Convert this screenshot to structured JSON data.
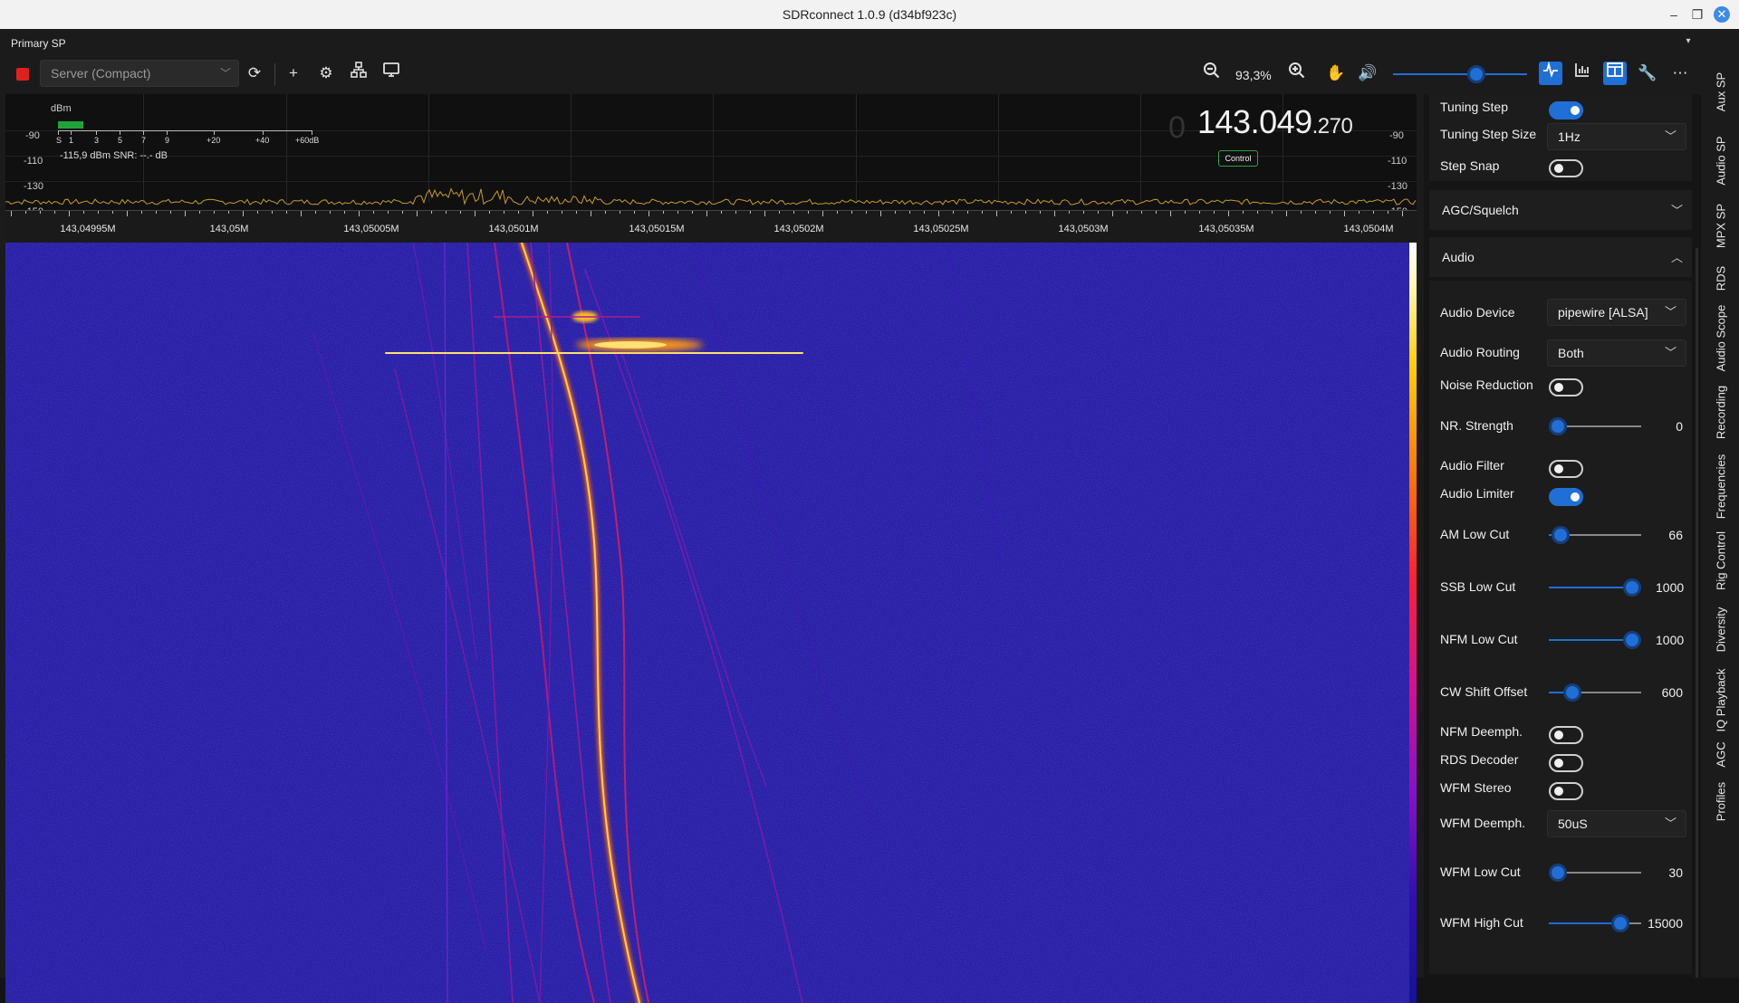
{
  "window": {
    "title": "SDRconnect 1.0.9 (d34bf923c)",
    "minimize": "–",
    "restore": "❐",
    "close": "✕"
  },
  "sp_label": "Primary SP",
  "toolbar": {
    "server_value": "Server (Compact)",
    "zoom_level": "93,3%",
    "volume_level": 0.64,
    "icons": [
      "stop-icon",
      "refresh-icon",
      "add-icon",
      "settings-icon",
      "network-icon",
      "display-icon",
      "zoom-out-icon",
      "zoom-in-icon",
      "hand-icon",
      "volume-icon",
      "waveform-icon",
      "histogram-icon",
      "layout-icon",
      "wrench-icon",
      "more-icon"
    ]
  },
  "spectrum": {
    "unit": "dBm",
    "levels_left": [
      "-90",
      "-110",
      "-130",
      "-150"
    ],
    "levels_right": [
      "-90",
      "-110",
      "-130",
      "-150"
    ],
    "smeter_labels": [
      "S",
      "1",
      "3",
      "5",
      "7",
      "9",
      "+20",
      "+40",
      "+60dB"
    ],
    "readout": "-115,9 dBm   SNR:  --.- dB",
    "freq_ghost": "0",
    "freq_main": "143.049",
    "freq_fine": ".270",
    "control_badge": "Control",
    "axis_labels": [
      "143,04995M",
      "143,05M",
      "143,05005M",
      "143,0501M",
      "143,05015M",
      "143,0502M",
      "143,05025M",
      "143,0503M",
      "143,05035M",
      "143,0504M"
    ]
  },
  "panel": {
    "tuning_step_label": "Tuning Step",
    "tuning_step_on": true,
    "tuning_step_size_label": "Tuning Step Size",
    "tuning_step_size_value": "1Hz",
    "step_snap_label": "Step Snap",
    "step_snap_on": false,
    "agc_header": "AGC/Squelch",
    "audio_header": "Audio",
    "audio_device_label": "Audio Device",
    "audio_device_value": "pipewire [ALSA]",
    "audio_routing_label": "Audio Routing",
    "audio_routing_value": "Both",
    "noise_reduction_label": "Noise Reduction",
    "noise_reduction_on": false,
    "nr_strength_label": "NR. Strength",
    "nr_strength_value": "0",
    "nr_strength_frac": 0.0,
    "audio_filter_label": "Audio Filter",
    "audio_filter_on": false,
    "audio_limiter_label": "Audio Limiter",
    "audio_limiter_on": true,
    "am_low_cut_label": "AM Low Cut",
    "am_low_cut_value": "66",
    "am_low_cut_frac": 0.04,
    "ssb_low_cut_label": "SSB Low Cut",
    "ssb_low_cut_value": "1000",
    "ssb_low_cut_frac": 1.0,
    "nfm_low_cut_label": "NFM Low Cut",
    "nfm_low_cut_value": "1000",
    "nfm_low_cut_frac": 1.0,
    "cw_shift_label": "CW Shift Offset",
    "cw_shift_value": "600",
    "cw_shift_frac": 0.2,
    "nfm_deemph_label": "NFM Deemph.",
    "nfm_deemph_on": false,
    "rds_decoder_label": "RDS Decoder",
    "rds_decoder_on": false,
    "wfm_stereo_label": "WFM Stereo",
    "wfm_stereo_on": false,
    "wfm_deemph_label": "WFM Deemph.",
    "wfm_deemph_value": "50uS",
    "wfm_low_cut_label": "WFM Low Cut",
    "wfm_low_cut_value": "30",
    "wfm_low_cut_frac": 0.0,
    "wfm_high_cut_label": "WFM High Cut",
    "wfm_high_cut_value": "15000",
    "wfm_high_cut_frac": 0.84
  },
  "side_tabs": [
    "Aux SP",
    "Audio SP",
    "MPX SP",
    "RDS",
    "Audio Scope",
    "Recording",
    "Frequencies",
    "Rig Control",
    "Diversity",
    "IQ Playback",
    "AGC",
    "Profiles"
  ],
  "colors": {
    "accent": "#1f6fd6",
    "stop": "#e02020",
    "waterfall_bg": "#16129a"
  }
}
